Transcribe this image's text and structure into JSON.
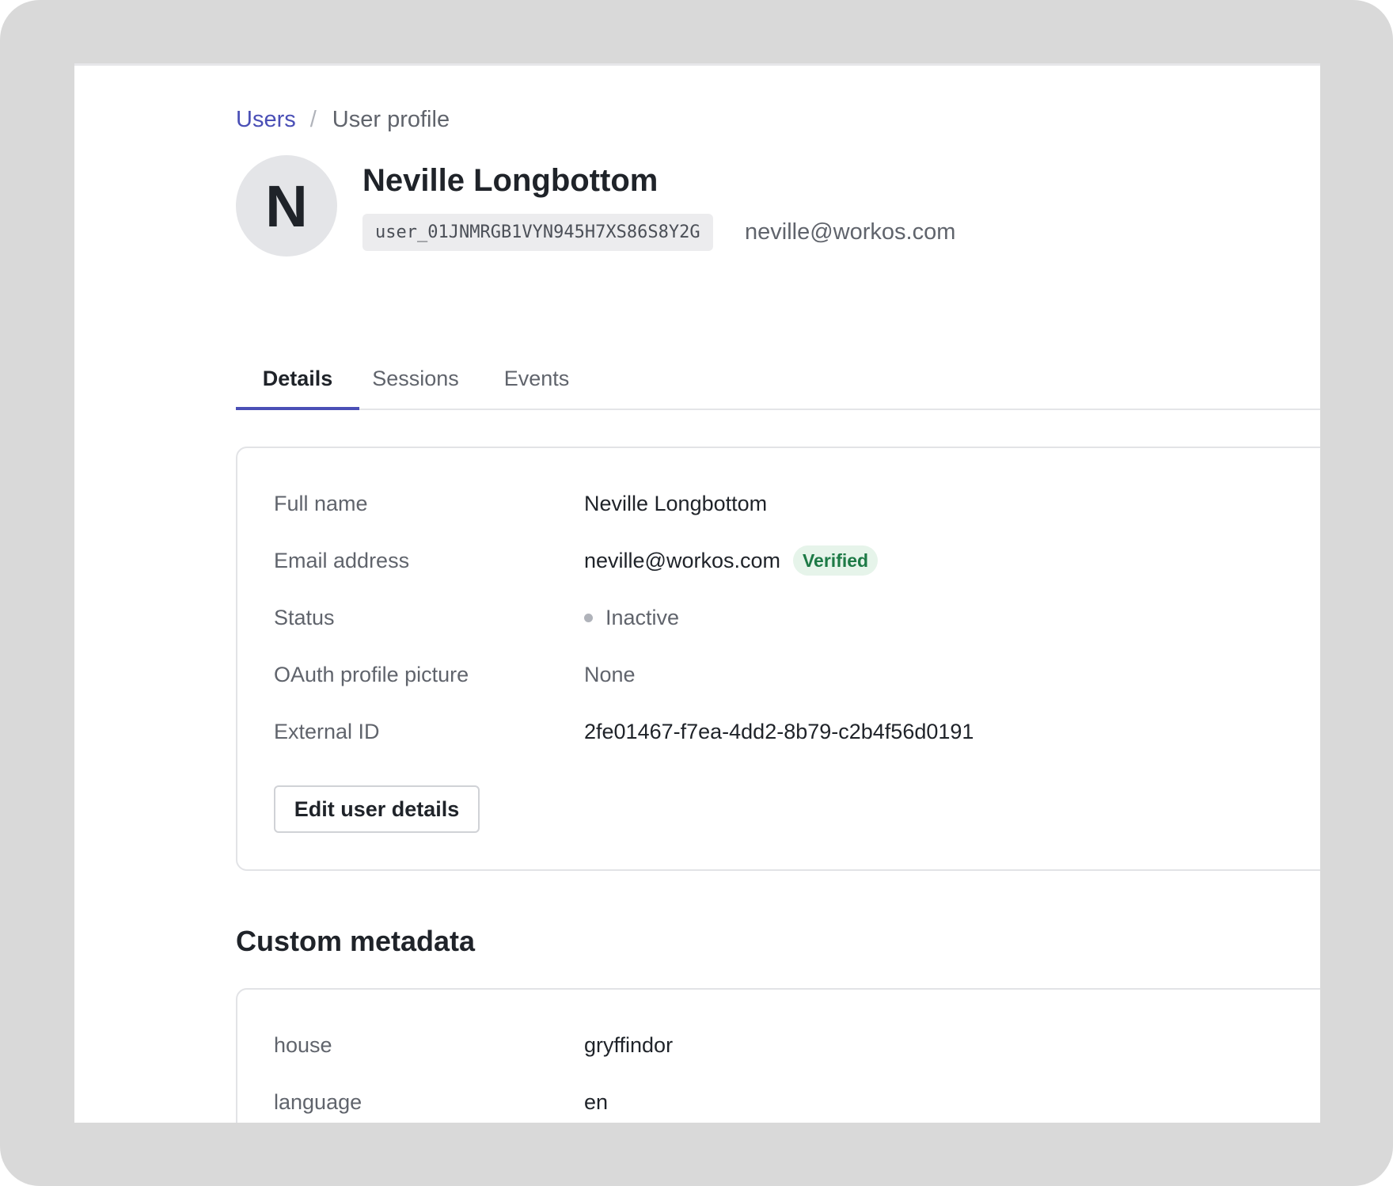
{
  "breadcrumb": {
    "parent": "Users",
    "separator": "/",
    "current": "User profile"
  },
  "user": {
    "initial": "N",
    "name": "Neville Longbottom",
    "id": "user_01JNMRGB1VYN945H7XS86S8Y2G",
    "email": "neville@workos.com"
  },
  "tabs": [
    {
      "label": "Details",
      "active": true
    },
    {
      "label": "Sessions",
      "active": false
    },
    {
      "label": "Events",
      "active": false
    }
  ],
  "details": {
    "full_name": {
      "label": "Full name",
      "value": "Neville Longbottom"
    },
    "email": {
      "label": "Email address",
      "value": "neville@workos.com",
      "badge": "Verified"
    },
    "status": {
      "label": "Status",
      "value": "Inactive"
    },
    "oauth_picture": {
      "label": "OAuth profile picture",
      "value": "None"
    },
    "external_id": {
      "label": "External ID",
      "value": "2fe01467-f7ea-4dd2-8b79-c2b4f56d0191"
    },
    "edit_button": "Edit user details"
  },
  "custom_metadata": {
    "title": "Custom metadata",
    "items": [
      {
        "key": "house",
        "value": "gryffindor"
      },
      {
        "key": "language",
        "value": "en"
      }
    ]
  },
  "colors": {
    "frame": "#d9d9d9",
    "accent": "#4a4fb6",
    "verified_bg": "#e6f4ea",
    "verified_text": "#1d7a46",
    "inactive_dot": "#b0b3ba"
  }
}
